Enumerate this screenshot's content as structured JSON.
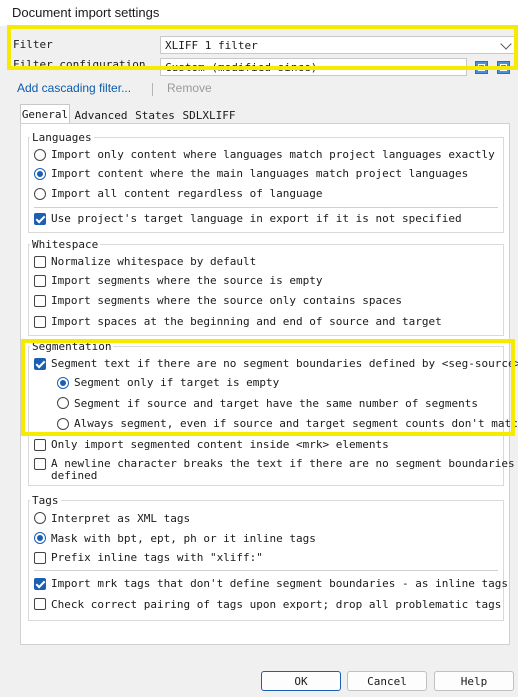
{
  "window": {
    "title": "Document import settings"
  },
  "filter": {
    "label": "Filter",
    "value": "XLIFF 1 filter",
    "config_label": "Filter configuration",
    "config_value": "Custom (modified since)"
  },
  "links": {
    "add": "Add cascading filter...",
    "remove": "Remove"
  },
  "tabs": [
    "General",
    "Advanced",
    "States",
    "SDLXLIFF"
  ],
  "languages": {
    "title": "Languages",
    "options": [
      {
        "label": "Import only content where languages match project languages exactly",
        "selected": false
      },
      {
        "label": "Import content where the main languages match project languages",
        "selected": true
      },
      {
        "label": "Import all content regardless of language",
        "selected": false
      }
    ],
    "target_lang": {
      "label": "Use project's target language in export if it is not specified",
      "checked": true
    }
  },
  "whitespace": {
    "title": "Whitespace",
    "items": [
      {
        "label": "Normalize whitespace by default",
        "checked": false
      },
      {
        "label": "Import segments where the source is empty",
        "checked": false
      },
      {
        "label": "Import segments where the source only contains spaces",
        "checked": false
      },
      {
        "label": "Import spaces at the beginning and end of source and target",
        "checked": false
      }
    ]
  },
  "segmentation": {
    "title": "Segmentation",
    "main": {
      "label": "Segment text if there are no segment boundaries defined by <seg-source>",
      "checked": true
    },
    "options": [
      {
        "label": "Segment only if target is empty",
        "selected": true
      },
      {
        "label": "Segment if source and target have the same number of segments",
        "selected": false
      },
      {
        "label": "Always segment, even if source and target segment counts don't match",
        "selected": false
      }
    ],
    "mrk_only": {
      "label": "Only import segmented content inside <mrk> elements",
      "checked": false
    },
    "newline": {
      "line1": "A newline character breaks the text if there are no segment boundaries",
      "line2": "defined",
      "checked": false
    }
  },
  "tags": {
    "title": "Tags",
    "options": [
      {
        "label": "Interpret as XML tags",
        "selected": false
      },
      {
        "label": "Mask with bpt, ept, ph or it inline tags",
        "selected": true
      }
    ],
    "prefix": {
      "label": "Prefix inline tags with \"xliff:\"",
      "checked": false
    },
    "mrk_inline": {
      "label": "Import mrk tags that don't define segment boundaries - as inline tags",
      "checked": true
    },
    "check_pairing": {
      "label": "Check correct pairing of tags upon export; drop all problematic tags",
      "checked": false
    }
  },
  "buttons": {
    "ok": "OK",
    "cancel": "Cancel",
    "help": "Help"
  },
  "colors": {
    "highlight": "#f5ea00",
    "accent": "#1a5fb4",
    "link": "#0b5cad"
  }
}
